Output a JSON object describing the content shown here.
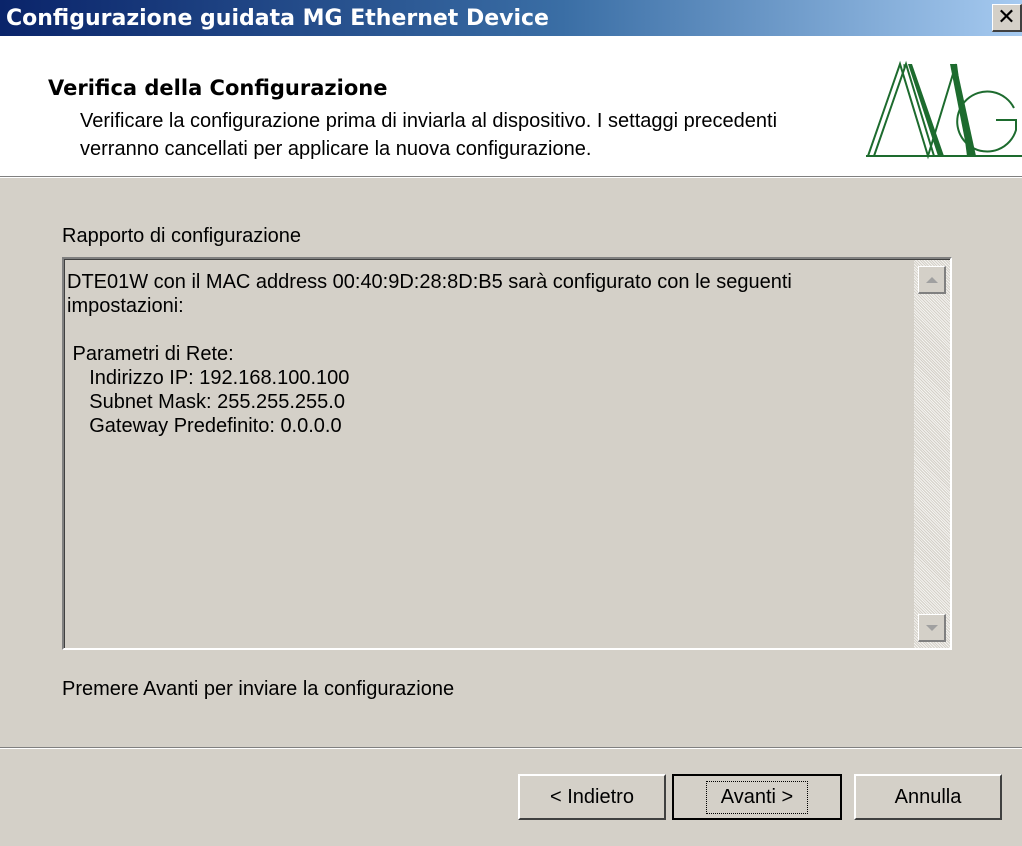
{
  "window": {
    "title": "Configurazione guidata MG Ethernet Device",
    "close_glyph": "✕"
  },
  "header": {
    "title": "Verifica della Configurazione",
    "description": "Verificare la configurazione prima di inviarla al dispositivo. I settaggi precedenti verranno cancellati per applicare la nuova configurazione.",
    "logo_text": "MG"
  },
  "report": {
    "label": "Rapporto di configurazione",
    "lines": [
      "DTE01W con il MAC address 00:40:9D:28:8D:B5 sarà configurato con le seguenti",
      "impostazioni:",
      "",
      " Parametri di Rete:",
      "    Indirizzo IP: 192.168.100.100",
      "    Subnet Mask: 255.255.255.0",
      "    Gateway Predefinito: 0.0.0.0"
    ]
  },
  "hint": "Premere Avanti per inviare la configurazione",
  "buttons": {
    "back": "< Indietro",
    "next": "Avanti >",
    "cancel": "Annulla"
  },
  "colors": {
    "titlebar_start": "#0a246a",
    "titlebar_end": "#a6caf0",
    "dialog_face": "#d4d0c8",
    "logo_green": "#1d6b2e"
  }
}
